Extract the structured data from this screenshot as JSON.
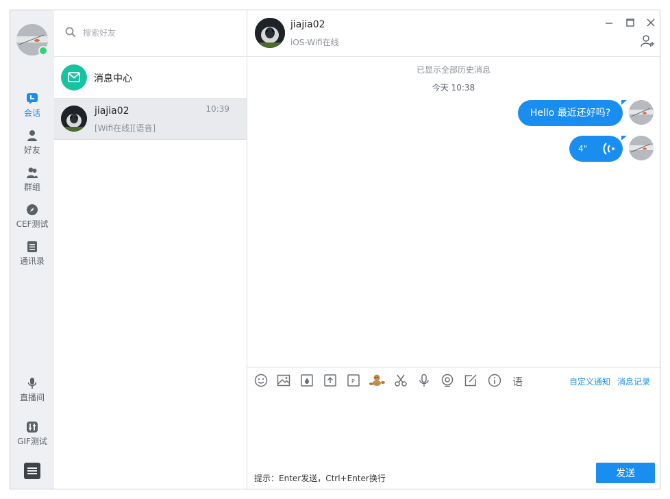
{
  "nav": {
    "items": [
      {
        "label": "会话",
        "icon": "chat-icon",
        "active": true
      },
      {
        "label": "好友",
        "icon": "user-icon"
      },
      {
        "label": "群组",
        "icon": "group-icon"
      },
      {
        "label": "CEF测试",
        "icon": "compass-icon"
      },
      {
        "label": "通讯录",
        "icon": "contacts-icon"
      }
    ],
    "bottom_items": [
      {
        "label": "直播间",
        "icon": "microphone-icon"
      },
      {
        "label": "GIF测试",
        "icon": "gif-icon"
      }
    ],
    "online_color": "#2ed573"
  },
  "search": {
    "placeholder": "搜索好友"
  },
  "message_center": {
    "label": "消息中心"
  },
  "session": {
    "name": "jiajia02",
    "preview": "[Wifi在线][语音]",
    "time": "10:39"
  },
  "chat": {
    "contact_name": "jiajia02",
    "contact_status": "iOS-Wifi在线",
    "history_note": "已显示全部历史消息",
    "day_note": "今天 10:38",
    "messages": [
      {
        "type": "text",
        "text": "Hello 最近还好吗?"
      },
      {
        "type": "voice",
        "duration": "4\""
      }
    ]
  },
  "input": {
    "links": [
      "自定义通知",
      "消息记录"
    ],
    "hint": "提示：Enter发送，Ctrl+Enter换行",
    "send_label": "发送",
    "tool_last_glyph": "语"
  },
  "colors": {
    "accent": "#1a8ef0",
    "message_center": "#18c3a1"
  }
}
